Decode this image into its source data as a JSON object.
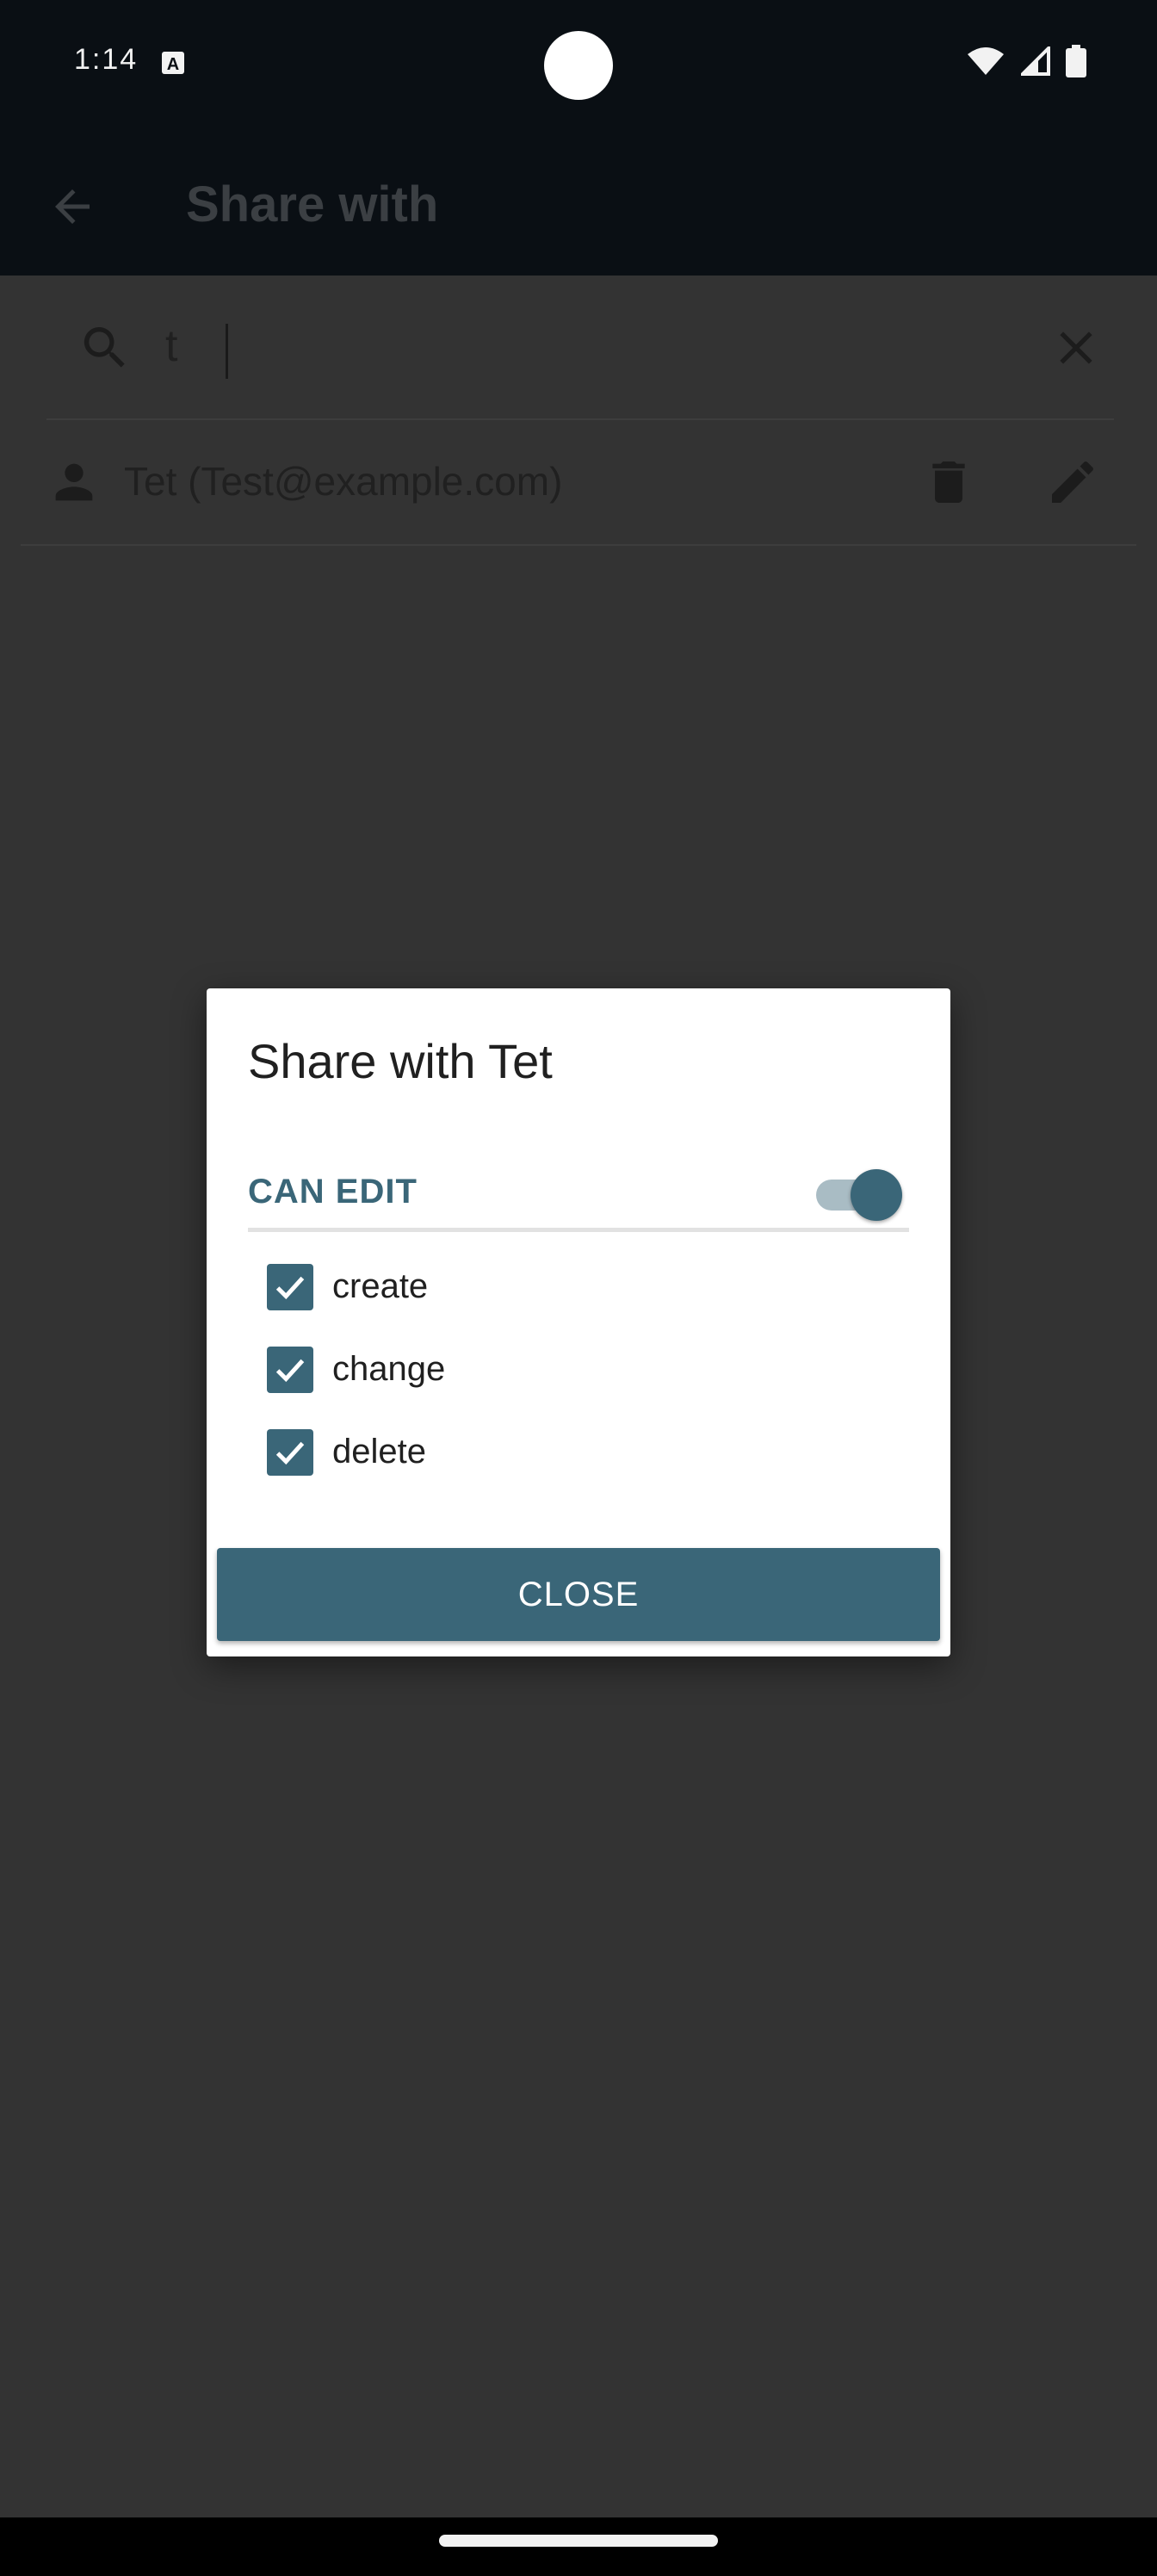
{
  "status_bar": {
    "time": "1:14",
    "a_icon": "A",
    "icons": [
      "wifi-icon",
      "signal-icon",
      "battery-icon"
    ]
  },
  "app_bar": {
    "title": "Share with",
    "back_icon": "arrow-left-icon"
  },
  "search": {
    "value": "t",
    "search_icon": "search-icon",
    "clear_icon": "close-icon"
  },
  "share_list": [
    {
      "label": "Tet (Test@example.com)",
      "icons": [
        "person-icon",
        "trash-icon",
        "edit-icon"
      ]
    }
  ],
  "dialog": {
    "title": "Share with Tet",
    "can_edit_label": "CAN EDIT",
    "can_edit_on": true,
    "permissions": [
      {
        "label": "create",
        "checked": true
      },
      {
        "label": "change",
        "checked": true
      },
      {
        "label": "delete",
        "checked": true
      }
    ],
    "close_label": "CLOSE"
  },
  "colors": {
    "accent": "#3a6678",
    "scrim": "#333333",
    "app_bar": "#0a0f14"
  }
}
